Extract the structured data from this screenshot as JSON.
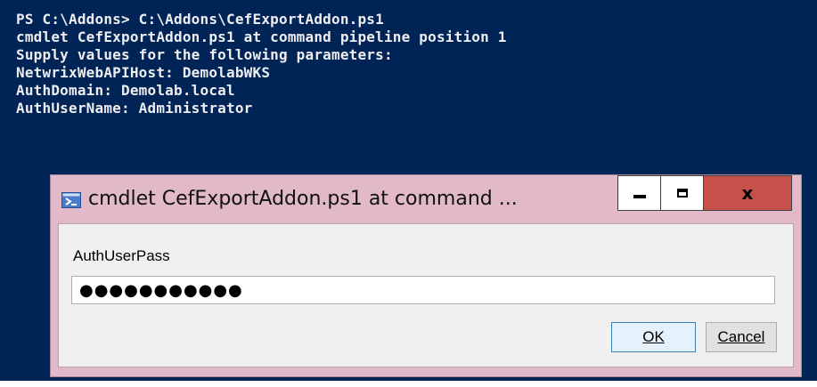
{
  "console": {
    "lines": [
      "PS C:\\Addons> C:\\Addons\\CefExportAddon.ps1",
      "cmdlet CefExportAddon.ps1 at command pipeline position 1",
      "Supply values for the following parameters:",
      "NetwrixWebAPIHost: DemolabWKS",
      "AuthDomain: Demolab.local",
      "AuthUserName: Administrator"
    ]
  },
  "dialog": {
    "title": "cmdlet CefExportAddon.ps1 at command ...",
    "icon": "powershell-icon",
    "close_glyph": "x",
    "field_label": "AuthUserPass",
    "password_value": "●●●●●●●●●●●",
    "ok_label": "OK",
    "cancel_label": "Cancel"
  },
  "colors": {
    "console_background": "#012456",
    "console_text": "#eeedf0",
    "dialog_frame": "#e1b9c9",
    "close_button": "#c7504b",
    "ok_button_border": "#3c7fb1"
  }
}
